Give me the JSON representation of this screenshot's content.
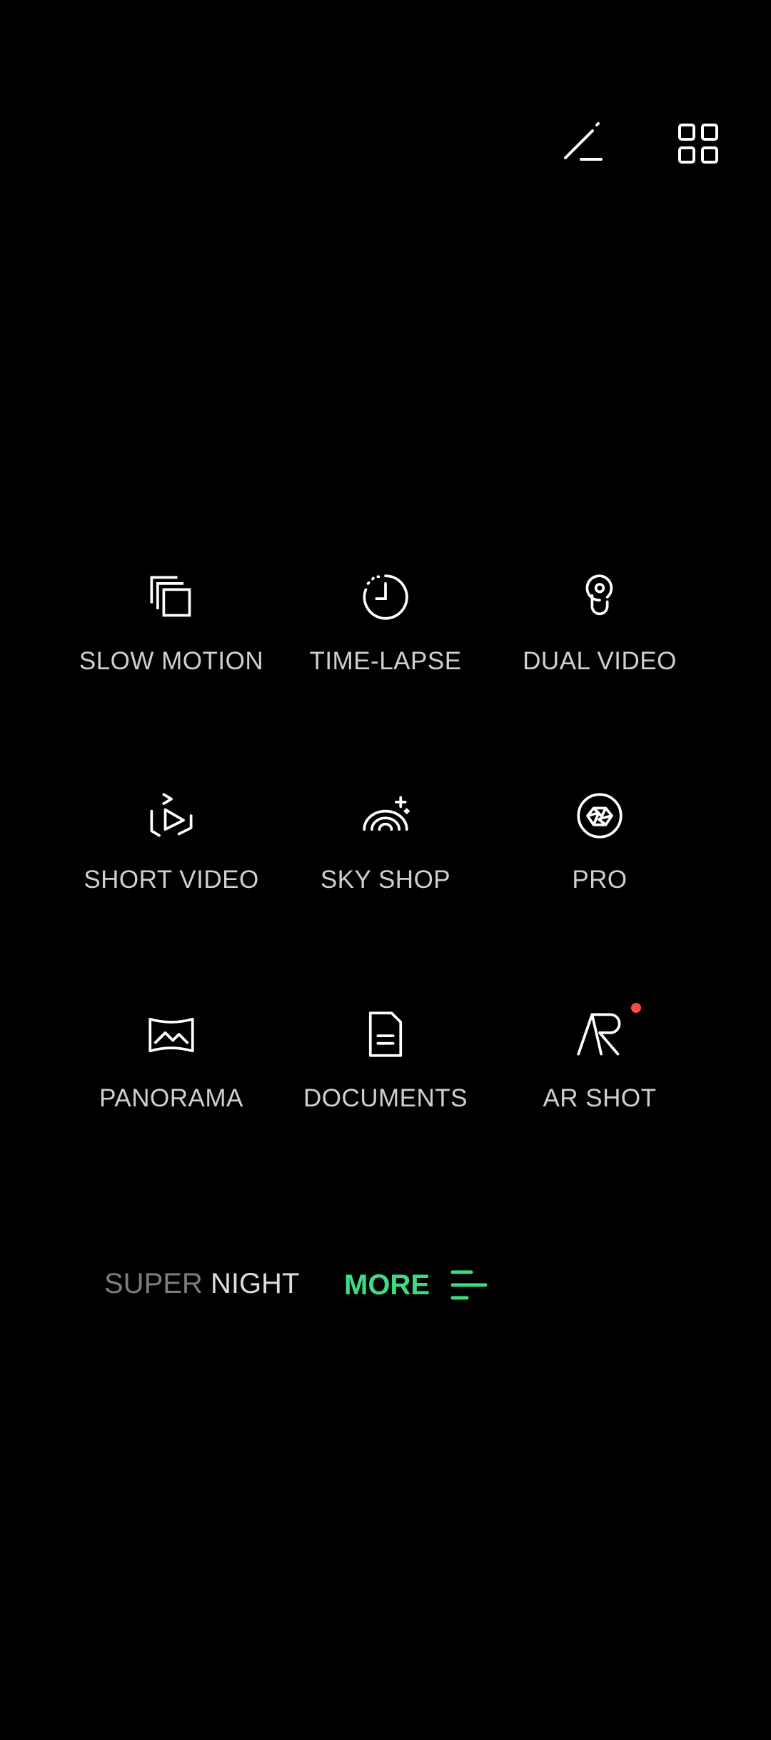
{
  "toolbar": {
    "edit_icon": "edit-pencil-icon",
    "grid_icon": "grid-layout-icon"
  },
  "modes": [
    [
      {
        "label": "SLOW MOTION",
        "icon": "slow-motion-icon"
      },
      {
        "label": "TIME-LAPSE",
        "icon": "time-lapse-icon"
      },
      {
        "label": "DUAL VIDEO",
        "icon": "dual-video-icon"
      }
    ],
    [
      {
        "label": "SHORT VIDEO",
        "icon": "short-video-icon"
      },
      {
        "label": "SKY SHOP",
        "icon": "sky-shop-icon"
      },
      {
        "label": "PRO",
        "icon": "pro-aperture-icon"
      }
    ],
    [
      {
        "label": "PANORAMA",
        "icon": "panorama-icon"
      },
      {
        "label": "DOCUMENTS",
        "icon": "documents-icon"
      },
      {
        "label": "AR SHOT",
        "icon": "ar-shot-icon",
        "badge": true
      }
    ]
  ],
  "bottom": {
    "super_night_part1": "SUPER",
    "super_night_part2": "NIGHT",
    "more_label": "MORE"
  },
  "colors": {
    "background": "#000000",
    "accent": "#3ddc84",
    "badge": "#ff4b3e",
    "text": "#cfcfcf"
  }
}
